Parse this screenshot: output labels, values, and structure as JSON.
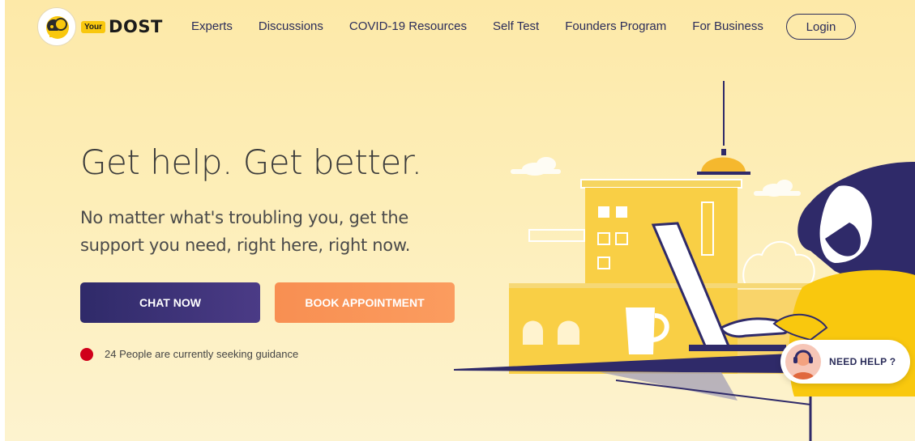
{
  "brand": {
    "badge": "Your",
    "name": "DOST"
  },
  "nav": {
    "links": [
      "Experts",
      "Discussions",
      "COVID-19 Resources",
      "Self Test",
      "Founders Program",
      "For Business"
    ],
    "login": "Login"
  },
  "hero": {
    "title": "Get help. Get better.",
    "subtitle": "No matter what's troubling you, get the support you need, right here, right now.",
    "chat_button": "CHAT NOW",
    "book_button": "BOOK APPOINTMENT",
    "status": "24 People are currently seeking guidance"
  },
  "help_widget": {
    "label": "NEED HELP ?"
  },
  "colors": {
    "primary": "#2f2a69",
    "accent": "#fb9c5f",
    "status_dot": "#d0001a",
    "background": "#fde9a8",
    "illustration_yellow": "#f9cf45"
  }
}
